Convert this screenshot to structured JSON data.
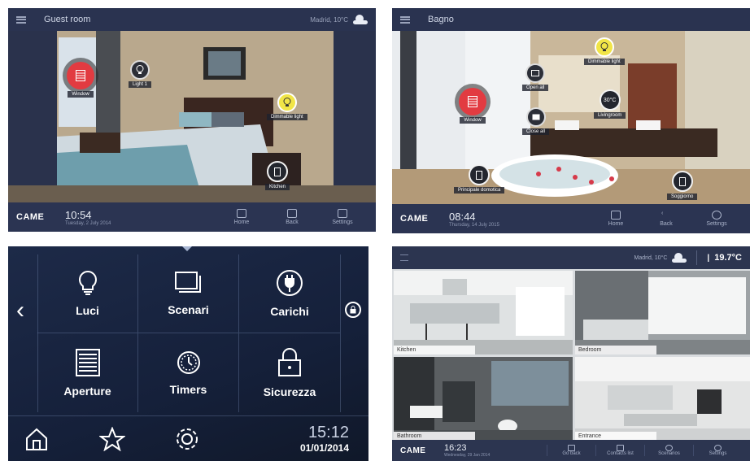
{
  "panel1": {
    "title": "Guest room",
    "weather_text": "Madrid, 10°C",
    "hotspots": {
      "window": "Window",
      "light1": "Light 1",
      "dimmable": "Dimmable light",
      "kitchen": "Kitchen"
    },
    "brand": "CAME",
    "time": "10:54",
    "date": "Tuesday, 2 July 2014",
    "nav": [
      "Home",
      "Back",
      "Settings"
    ]
  },
  "panel2": {
    "title": "Bagno",
    "hotspots": {
      "window": "Window",
      "open_all": "Open all",
      "close_all": "Close all",
      "dimmable": "Dimmable light",
      "temp_value": "30°C",
      "livingroom": "Livingroom",
      "principale": "Principale domotica",
      "soggiorno": "Soggiorno"
    },
    "brand": "CAME",
    "time": "08:44",
    "date": "Thursday, 14 July 2015",
    "nav": [
      "Home",
      "Back",
      "Settings"
    ]
  },
  "panel3": {
    "tiles": [
      "Luci",
      "Scenari",
      "Carichi",
      "Aperture",
      "Timers",
      "Sicurezza"
    ],
    "time": "15:12",
    "date": "01/01/2014"
  },
  "panel4": {
    "weather_text": "Madrid, 10°C",
    "temperature": "19.7°C",
    "rooms": [
      "Kitchen",
      "Bedroom",
      "Bathroom",
      "Entrance"
    ],
    "brand": "CAME",
    "time": "16:23",
    "date": "Wednesday, 29 Jan 2014",
    "nav": [
      "Go back",
      "Contacts list",
      "Scenarios",
      "Settings"
    ]
  },
  "colors": {
    "accent_red": "#e23b41",
    "accent_yellow": "#f1e547",
    "bar_bg": "#2b3452"
  }
}
